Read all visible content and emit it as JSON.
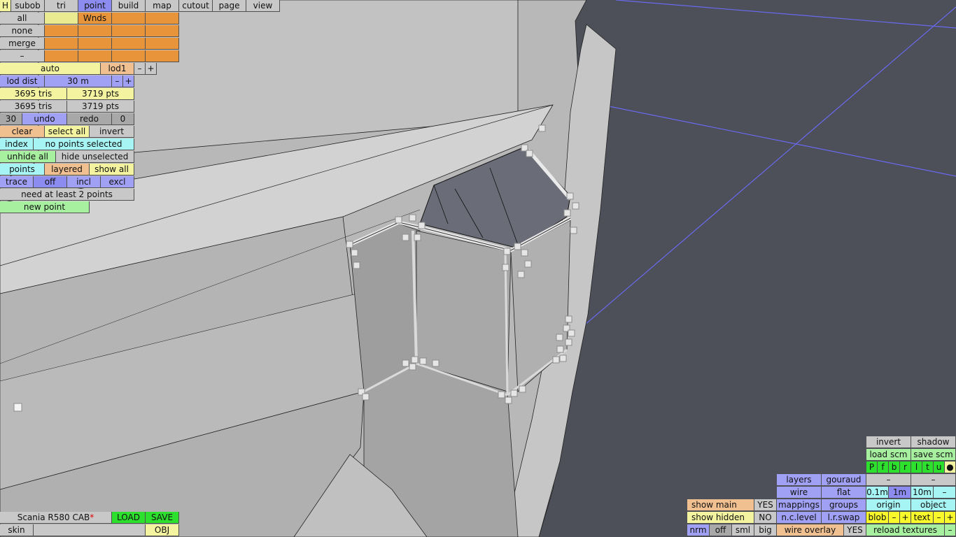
{
  "top_tabs": {
    "h": "H",
    "items": [
      "subob",
      "tri",
      "point",
      "build",
      "map",
      "cutout",
      "page",
      "view"
    ],
    "active": "point"
  },
  "selection": {
    "all": "all",
    "none": "none",
    "merge": "merge",
    "minus": "–",
    "wnds": "Wnds"
  },
  "lod": {
    "auto": "auto",
    "lod1": "lod1",
    "minus": "–",
    "plus": "+",
    "dist_label": "lod dist",
    "dist_value": "30 m"
  },
  "stats": {
    "tris_a": "3695 tris",
    "pts_a": "3719 pts",
    "tris_b": "3695 tris",
    "pts_b": "3719 pts"
  },
  "undo": {
    "count": "30",
    "undo": "undo",
    "redo": "redo",
    "redo_count": "0"
  },
  "sel_ops": {
    "clear": "clear",
    "select_all": "select all",
    "invert": "invert"
  },
  "index": {
    "label": "index",
    "status": "no points selected"
  },
  "hide": {
    "unhide_all": "unhide all",
    "hide_unselected": "hide unselected"
  },
  "points_row": {
    "points": "points",
    "layered": "layered",
    "show_all": "show all"
  },
  "trace": {
    "trace": "trace",
    "off": "off",
    "incl": "incl",
    "excl": "excl"
  },
  "msg": {
    "need": "need at least 2 points",
    "new_point": "new point"
  },
  "file": {
    "name": "Scania R580 CAB",
    "modified": "*",
    "load": "LOAD",
    "save": "SAVE",
    "skin": "skin",
    "obj": "OBJ"
  },
  "bottom_right": {
    "invert": "invert",
    "shadow": "shadow",
    "load_scm": "load scm",
    "save_scm": "save scm",
    "flags": [
      "P",
      "f",
      "b",
      "r",
      "l",
      "t",
      "u",
      "●"
    ],
    "layers": "layers",
    "gouraud": "gouraud",
    "dash1": "–",
    "dash2": "–",
    "wire": "wire",
    "flat": "flat",
    "grid_01": "0.1m",
    "grid_1": "1m",
    "grid_10": "10m",
    "grid_minus": "–",
    "show_main": "show main",
    "show_main_val": "YES",
    "mappings": "mappings",
    "groups": "groups",
    "origin": "origin",
    "object": "object",
    "show_hidden": "show hidden",
    "show_hidden_val": "NO",
    "nc_level": "n.c.level",
    "lr_swap": "l.r.swap",
    "blob": "blob",
    "blob_minus": "–",
    "blob_plus": "+",
    "text": "text",
    "text_minus": "–",
    "text_plus": "+",
    "nrm": "nrm",
    "off": "off",
    "sml": "sml",
    "big": "big",
    "wire_overlay": "wire overlay",
    "wire_overlay_val": "YES",
    "reload": "reload textures",
    "reload_minus": "–"
  },
  "colors": {
    "background": "#4d4f59",
    "grid": "#6a6af0",
    "mesh": "#c4c4c4",
    "point": "#e6e6e6"
  }
}
